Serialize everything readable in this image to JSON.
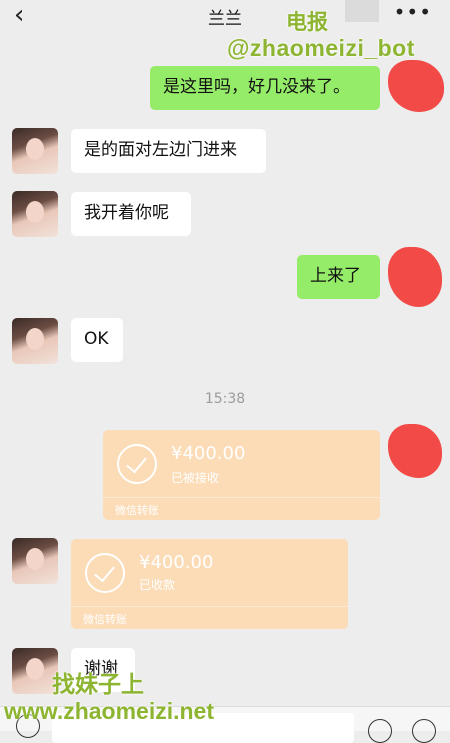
{
  "header": {
    "back_icon": "‹",
    "title": "兰兰",
    "more_icon": "•••"
  },
  "watermarks": {
    "telegram": "电报",
    "bot": "@zhaomeizi_bot",
    "find": "找妹子上",
    "site": "www.zhaomeizi.net"
  },
  "messages": [
    {
      "side": "out",
      "text": "是这里吗，好几没来了。"
    },
    {
      "side": "in",
      "text": "是的面对左边门进来"
    },
    {
      "side": "in",
      "text": "我开着你呢"
    },
    {
      "side": "out",
      "text": "上来了"
    },
    {
      "side": "in",
      "text": "OK"
    },
    {
      "side": "in",
      "text": "谢谢"
    }
  ],
  "timestamp": "15:38",
  "transfers": [
    {
      "side": "out",
      "amount": "¥400.00",
      "status": "已被接收",
      "footer": "微信转账"
    },
    {
      "side": "in",
      "amount": "¥400.00",
      "status": "已收款",
      "footer": "微信转账"
    }
  ],
  "colors": {
    "incoming_bubble": "#ffffff",
    "outgoing_bubble": "#95ec69",
    "transfer_card": "#fbdcb7",
    "background": "#ededed",
    "redaction": "#f24b47"
  },
  "icons": {
    "voice": "voice-icon",
    "emoji": "emoji-icon",
    "plus": "plus-icon"
  }
}
